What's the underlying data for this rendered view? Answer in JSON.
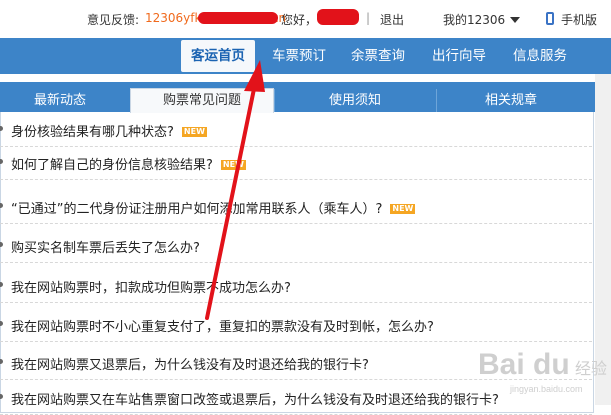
{
  "topbar": {
    "feedback_label": "意见反馈:",
    "feedback_email": "12306yfk@rails.com.cn",
    "greeting": "您好，",
    "sep": "|",
    "logout": "退出",
    "my12306": "我的12306",
    "mobile": "手机版"
  },
  "nav": {
    "items": [
      "客运首页",
      "车票预订",
      "余票查询",
      "出行向导",
      "信息服务"
    ],
    "active": "客运首页"
  },
  "subtabs": {
    "items": [
      "最新动态",
      "购票常见问题",
      "使用须知",
      "相关规章"
    ],
    "active": "购票常见问题"
  },
  "faq": [
    {
      "text": "身份核验结果有哪几种状态?",
      "badge": "NEW"
    },
    {
      "text": "如何了解自己的身份信息核验结果?",
      "badge": "NEW"
    },
    {
      "text": "“已通过”的二代身份证注册用户如何添加常用联系人（乘车人）?",
      "badge": "NEW"
    },
    {
      "text": "购买实名制车票后丢失了怎么办?",
      "badge": ""
    },
    {
      "text": "我在网站购票时，扣款成功但购票不成功怎么办?",
      "badge": ""
    },
    {
      "text": "我在网站购票时不小心重复支付了，重复扣的票款没有及时到帐，怎么办?",
      "badge": ""
    },
    {
      "text": "我在网站购票又退票后，为什么钱没有及时退还给我的银行卡?",
      "badge": ""
    },
    {
      "text": "我在网站购票又在车站售票窗口改签或退票后，为什么钱没有及时退还给我的银行卡?",
      "badge": ""
    }
  ],
  "watermark": {
    "brand": "Bai du",
    "sub": "经验",
    "url": "jingyan.baidu.com"
  },
  "colors": {
    "nav": "#3d84c8",
    "arrow": "#e2121a",
    "orange": "#f06a1d",
    "badge": "#f5a623"
  }
}
